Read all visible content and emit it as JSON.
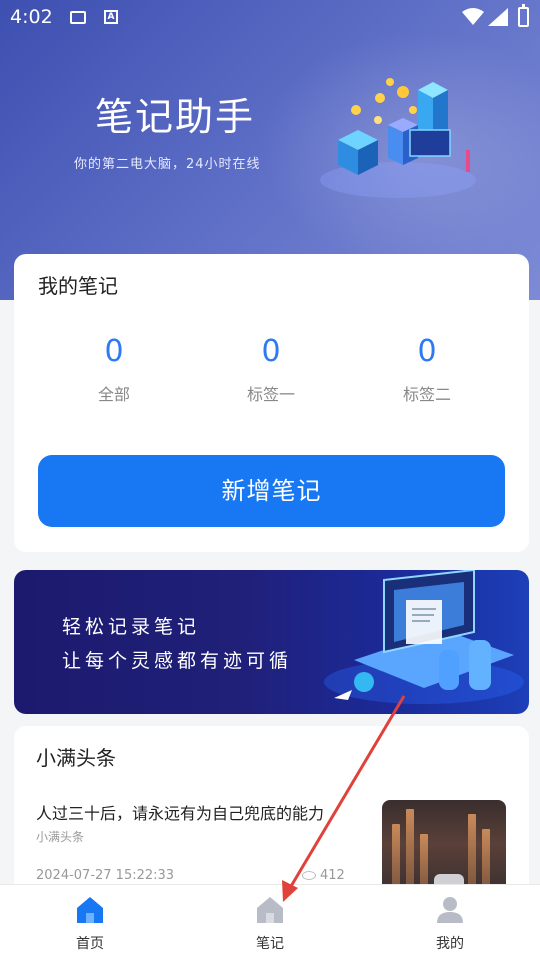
{
  "status_bar": {
    "time": "4:02",
    "icons": [
      "image-icon",
      "a-icon",
      "wifi-icon",
      "signal-icon",
      "battery-icon"
    ]
  },
  "hero": {
    "title": "笔记助手",
    "subtitle": "你的第二电大脑，24小时在线"
  },
  "notes_card": {
    "title": "我的笔记",
    "stats": [
      {
        "value": "0",
        "label": "全部"
      },
      {
        "value": "0",
        "label": "标签一"
      },
      {
        "value": "0",
        "label": "标签二"
      }
    ],
    "add_button": "新增笔记"
  },
  "banner": {
    "line1": "轻松记录笔记",
    "line2": "让每个灵感都有迹可循"
  },
  "news": {
    "heading": "小满头条",
    "items": [
      {
        "title": "人过三十后，请永远有为自己兜底的能力",
        "source": "小满头条",
        "date": "2024-07-27 15:22:33",
        "views": "412"
      }
    ]
  },
  "tabbar": {
    "tabs": [
      {
        "label": "首页",
        "icon": "home-icon",
        "active": true
      },
      {
        "label": "笔记",
        "icon": "home-icon",
        "active": false
      },
      {
        "label": "我的",
        "icon": "user-icon",
        "active": false
      }
    ]
  },
  "colors": {
    "accent": "#1877f2",
    "stat_number": "#2f7af2",
    "hero_start": "#3d4fb0",
    "arrow": "#e0413a"
  }
}
